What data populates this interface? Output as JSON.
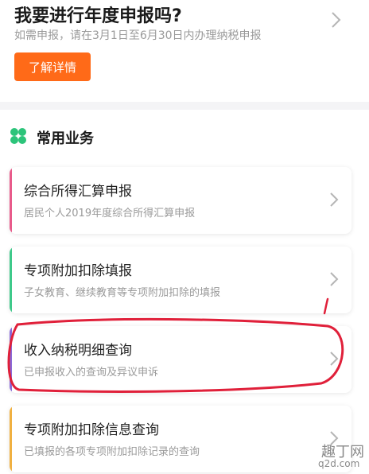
{
  "annual_filing": {
    "title": "我要进行年度申报吗?",
    "subtitle": "如需申报，请在3月1日至6月30日内办理纳税申报",
    "button_label": "了解详情"
  },
  "common_services": {
    "title": "常用业务",
    "icon": "clover-icon",
    "items": [
      {
        "title": "综合所得汇算申报",
        "desc": "居民个人2019年度综合所得汇算申报",
        "accent": "#e85a8a"
      },
      {
        "title": "专项附加扣除填报",
        "desc": "子女教育、继续教育等专项附加扣除的填报",
        "accent": "#3ec98a"
      },
      {
        "title": "收入纳税明细查询",
        "desc": "已申报收入的查询及异议申诉",
        "accent": "#8a6ad8"
      },
      {
        "title": "专项附加扣除信息查询",
        "desc": "已填报的各项专项附加扣除记录的查询",
        "accent": "#f0b040"
      }
    ]
  },
  "colors": {
    "primary_button": "#ff6a18",
    "clover": "#2cc47a",
    "annotation": "#e0203a"
  },
  "watermark": {
    "name": "趣丁网",
    "url": "q2d.com"
  }
}
